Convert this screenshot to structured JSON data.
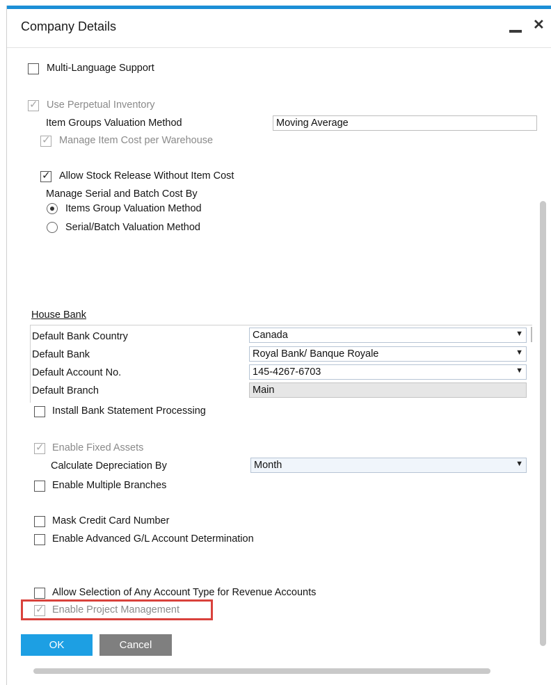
{
  "window": {
    "title": "Company Details",
    "minimize_icon": "minimize-icon",
    "close_icon": "close-icon",
    "close_glyph": "✕"
  },
  "inventory": {
    "multi_language": {
      "label": "Multi-Language Support",
      "checked": false
    },
    "perpetual_inventory": {
      "label": "Use Perpetual Inventory",
      "checked": true,
      "disabled": true
    },
    "item_groups_valuation_label": "Item Groups Valuation Method",
    "item_groups_valuation_value": "Moving Average",
    "manage_cost_per_warehouse": {
      "label": "Manage Item Cost per Warehouse",
      "checked": true,
      "disabled": true
    },
    "allow_stock_release": {
      "label": "Allow Stock Release Without Item Cost",
      "checked": true
    },
    "serial_batch_heading": "Manage Serial and Batch Cost By",
    "radio_items_group": {
      "label": "Items Group Valuation Method",
      "selected": true
    },
    "radio_serial_batch": {
      "label": "Serial/Batch Valuation Method",
      "selected": false
    }
  },
  "house_bank": {
    "title": "House Bank",
    "rows": [
      {
        "label": "Default Bank Country",
        "value": "Canada"
      },
      {
        "label": "Default Bank",
        "value": "Royal Bank/ Banque Royale"
      },
      {
        "label": "Default Account No.",
        "value": "145-4267-6703"
      },
      {
        "label": "Default Branch",
        "value": "Main"
      }
    ]
  },
  "options": {
    "install_bank_statement": {
      "label": "Install Bank Statement Processing",
      "checked": false
    },
    "enable_fixed_assets": {
      "label": "Enable Fixed Assets",
      "checked": true,
      "disabled": true
    },
    "calc_depreciation_label": "Calculate Depreciation By",
    "calc_depreciation_value": "Month",
    "enable_multiple_branches": {
      "label": "Enable Multiple Branches",
      "checked": false
    },
    "mask_credit_card": {
      "label": "Mask Credit Card Number",
      "checked": false
    },
    "advanced_gl": {
      "label": "Enable Advanced G/L Account Determination",
      "checked": false
    },
    "allow_any_account_type": {
      "label": "Allow Selection of Any Account Type for Revenue Accounts",
      "checked": false
    },
    "enable_project_management": {
      "label": "Enable Project Management",
      "checked": true,
      "disabled": true
    }
  },
  "buttons": {
    "ok": "OK",
    "cancel": "Cancel"
  },
  "glyphs": {
    "check": "✓",
    "dropdown": "▼"
  },
  "colors": {
    "accent": "#1d9fe3",
    "highlight": "#d9423c",
    "cancel": "#7f7f7f"
  }
}
